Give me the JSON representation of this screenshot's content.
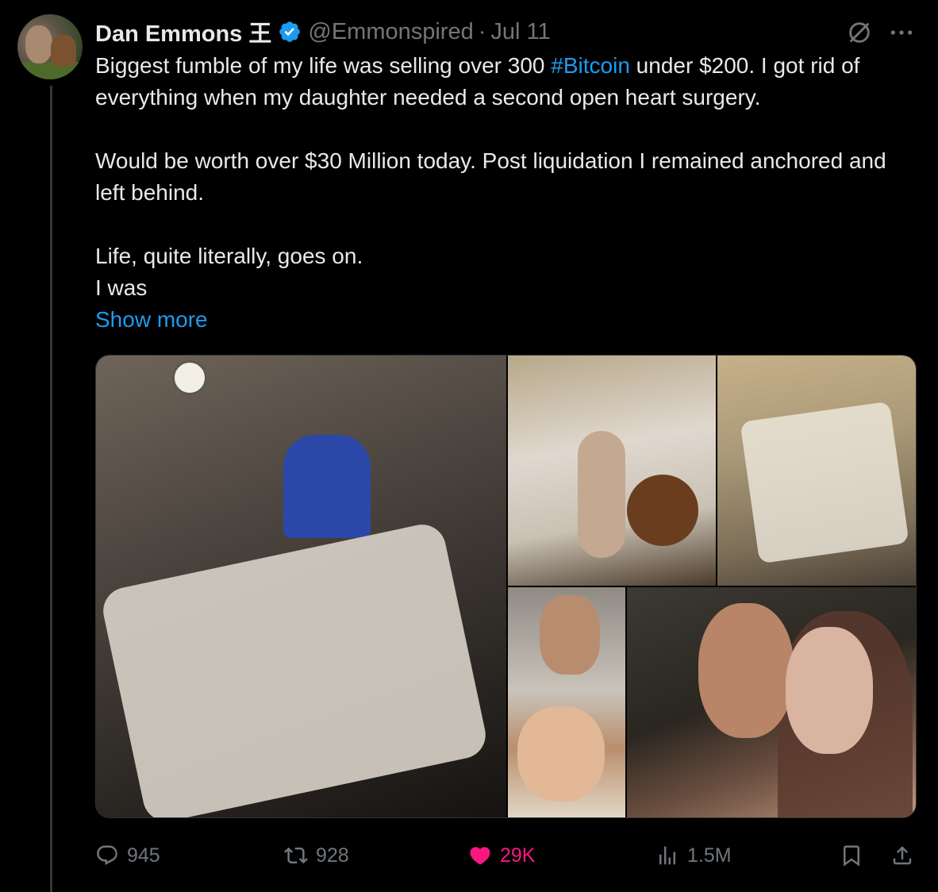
{
  "author": {
    "display_name": "Dan Emmons 王",
    "handle": "@Emmonspired",
    "separator": "·",
    "date": "Jul 11"
  },
  "tweet": {
    "line1_pre": "Biggest fumble of my life was selling over 300 ",
    "hashtag": "#Bitcoin",
    "line1_post": " under $200. I got rid of everything when my daughter needed a second open heart surgery.",
    "para2": "Would be worth over $30 Million today. Post liquidation I remained anchored and left behind.",
    "para3_line1": "Life, quite literally, goes on.",
    "para3_line2": "I was",
    "show_more": "Show more"
  },
  "actions": {
    "replies": "945",
    "retweets": "928",
    "likes": "29K",
    "views": "1.5M"
  },
  "colors": {
    "background": "#000000",
    "text": "#e7e9ea",
    "muted": "#71767b",
    "link": "#1d9bf0",
    "like": "#f91880",
    "verified": "#1d9bf0"
  },
  "icons": [
    "verified-badge-icon",
    "grok-icon",
    "more-icon",
    "reply-icon",
    "retweet-icon",
    "heart-icon",
    "views-icon",
    "bookmark-icon",
    "share-icon"
  ]
}
